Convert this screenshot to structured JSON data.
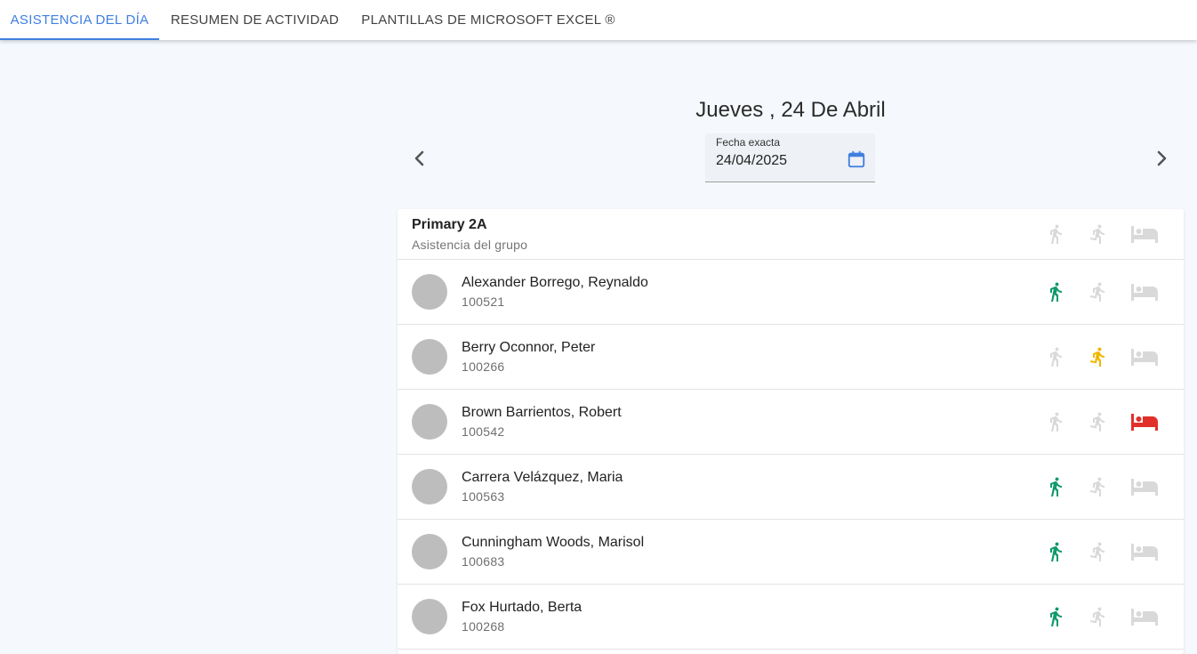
{
  "tabs": [
    {
      "label": "ASISTENCIA DEL DÍA",
      "active": true
    },
    {
      "label": "RESUMEN DE ACTIVIDAD",
      "active": false
    },
    {
      "label": "PLANTILLAS DE MICROSOFT EXCEL ®",
      "active": false
    }
  ],
  "date": {
    "title": "Jueves , 24 De Abril",
    "field_label": "Fecha exacta",
    "field_value": "24/04/2025"
  },
  "group": {
    "name": "Primary 2A",
    "subtitle": "Asistencia del grupo"
  },
  "colors": {
    "accent": "#3f7fe0",
    "present": "#119a6a",
    "late": "#f2b600",
    "absent": "#e1302a",
    "inactive": "#d9d9d9"
  },
  "icons": {
    "present": "walk-icon",
    "late": "run-icon",
    "absent": "bed-icon",
    "prev": "chevron-left-icon",
    "next": "chevron-right-icon",
    "calendar": "calendar-icon"
  },
  "students": [
    {
      "name": "Alexander Borrego, Reynaldo",
      "id": "100521",
      "status": "present"
    },
    {
      "name": "Berry Oconnor, Peter",
      "id": "100266",
      "status": "late"
    },
    {
      "name": "Brown Barrientos, Robert",
      "id": "100542",
      "status": "absent"
    },
    {
      "name": "Carrera Velázquez, Maria",
      "id": "100563",
      "status": "present"
    },
    {
      "name": "Cunningham Woods, Marisol",
      "id": "100683",
      "status": "present"
    },
    {
      "name": "Fox Hurtado, Berta",
      "id": "100268",
      "status": "present"
    }
  ]
}
